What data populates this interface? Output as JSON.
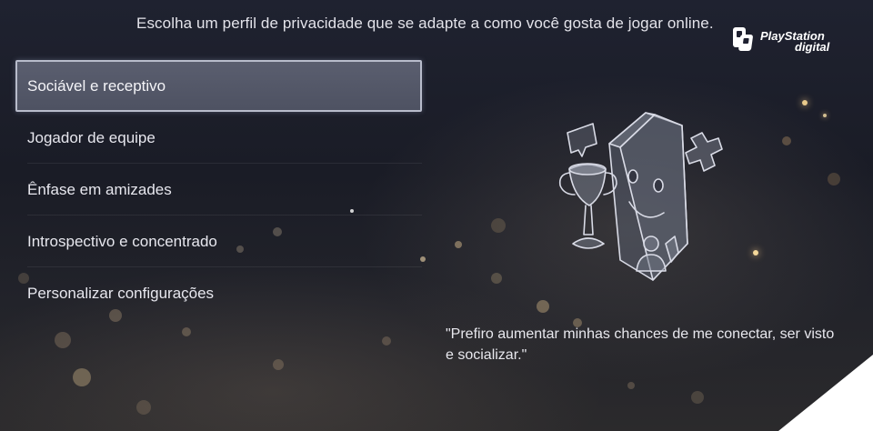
{
  "header": {
    "prompt": "Escolha um perfil de privacidade que se adapte a como você gosta de jogar online."
  },
  "logo": {
    "line1": "PlayStation",
    "line2": "digital",
    "icon": "playstation-digital-logo"
  },
  "menu": {
    "items": [
      {
        "label": "Sociável e receptivo",
        "selected": true
      },
      {
        "label": "Jogador de equipe",
        "selected": false
      },
      {
        "label": "Ênfase em amizades",
        "selected": false
      },
      {
        "label": "Introspectivo e concentrado",
        "selected": false
      },
      {
        "label": "Personalizar configurações",
        "selected": false
      }
    ]
  },
  "illustration": {
    "icon": "social-profile-illustration"
  },
  "description": {
    "quote": "\"Prefiro aumentar minhas chances de me conectar, ser visto e socializar.\""
  },
  "colors": {
    "background": "#1f2230",
    "selected_item": "#5a5e6f",
    "selected_border": "#b8bccb",
    "text": "#e7e7ee"
  }
}
